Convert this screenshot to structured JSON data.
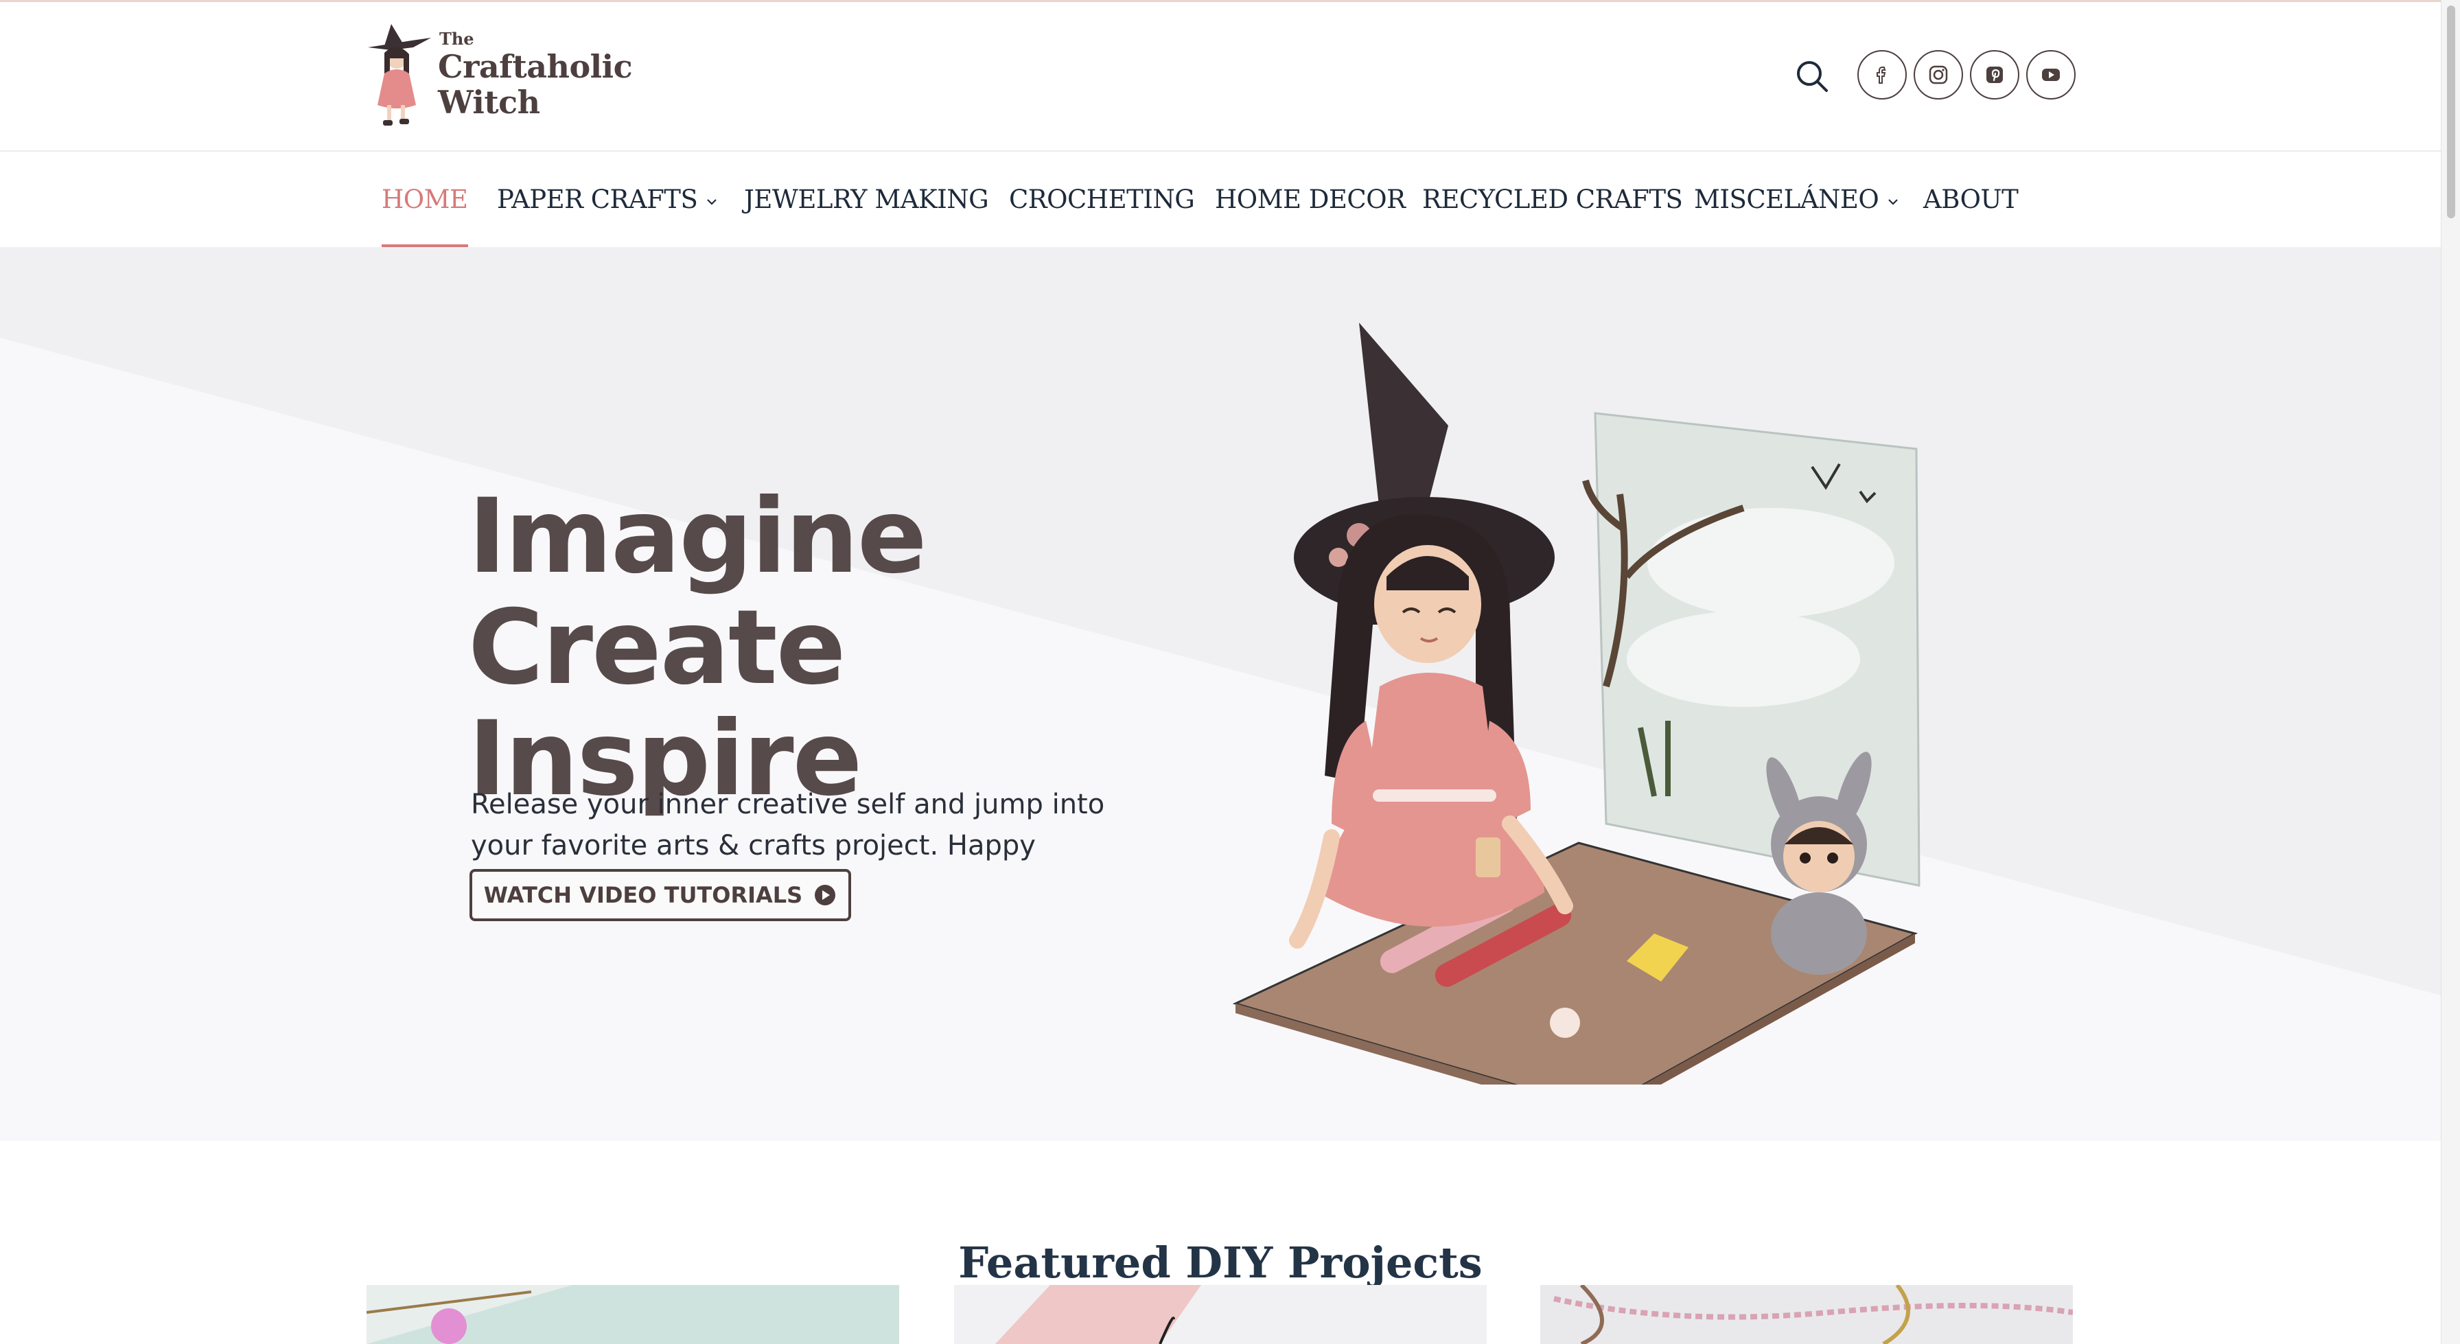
{
  "site": {
    "logo_the": "The",
    "logo_line1": "Craftaholic",
    "logo_line2": "Witch"
  },
  "header": {
    "search_icon": "search-icon",
    "socials": [
      {
        "name": "facebook",
        "icon": "facebook-icon"
      },
      {
        "name": "instagram",
        "icon": "instagram-icon"
      },
      {
        "name": "pinterest",
        "icon": "pinterest-icon"
      },
      {
        "name": "youtube",
        "icon": "youtube-icon"
      }
    ]
  },
  "nav": {
    "items": [
      {
        "label": "HOME",
        "active": true
      },
      {
        "label": "PAPER CRAFTS",
        "dropdown": true
      },
      {
        "label": "JEWELRY MAKING"
      },
      {
        "label": "CROCHETING"
      },
      {
        "label": "HOME DECOR"
      },
      {
        "label": "RECYCLED CRAFTS"
      },
      {
        "label": "MISCELÁNEO",
        "dropdown": true
      },
      {
        "label": "ABOUT"
      }
    ]
  },
  "hero": {
    "headline": [
      "Imagine",
      "Create",
      "Inspire"
    ],
    "subtext": "Release your inner creative self and jump into your favorite arts & crafts project. Happy Crafting!!",
    "cta_label": "WATCH VIDEO TUTORIALS",
    "cta_icon": "play-circle-icon"
  },
  "featured": {
    "title": "Featured DIY Projects"
  },
  "colors": {
    "brand_dark": "#4e3f3f",
    "accent": "#d77a7a",
    "nav_text": "#1e2a3a",
    "hero_bg": "#f0f0f3"
  }
}
